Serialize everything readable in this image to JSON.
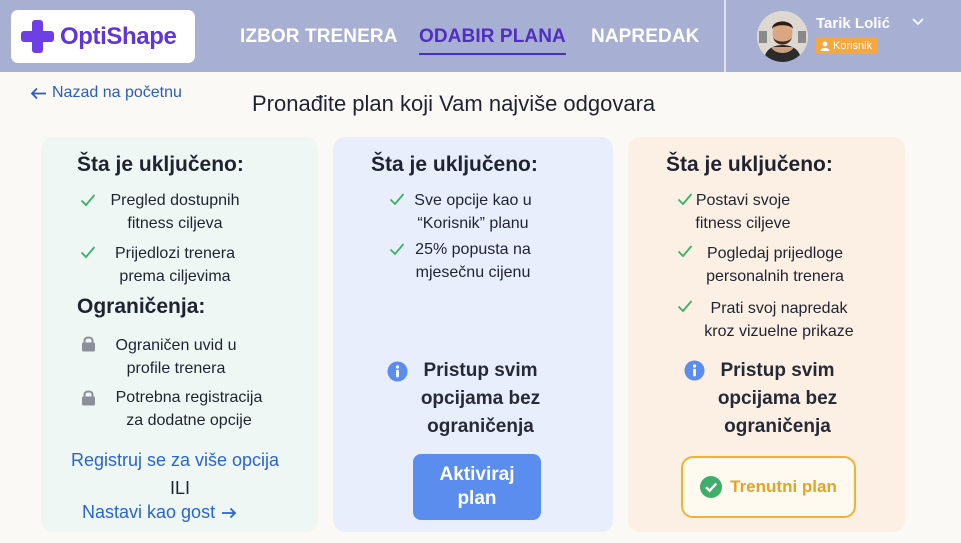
{
  "brand": {
    "name": "OptiShape"
  },
  "nav": {
    "links": [
      {
        "label": "IZBOR TRENERA",
        "active": false
      },
      {
        "label": "ODABIR PLANA",
        "active": true
      },
      {
        "label": "NAPREDAK",
        "active": false
      }
    ]
  },
  "user": {
    "name": "Tarik Lolić",
    "role": "Korisnik"
  },
  "back_link": "Nazad na početnu",
  "page_title": "Pronađite plan koji Vam najviše odgovara",
  "plans": [
    {
      "included_heading": "Šta je uključeno:",
      "included": [
        {
          "line1": "Pregled dostupnih",
          "line2": "fitness ciljeva"
        },
        {
          "line1": "Prijedlozi trenera",
          "line2": "prema ciljevima"
        }
      ],
      "limits_heading": "Ograničenja:",
      "limits": [
        {
          "line1": "Ograničen uvid u",
          "line2": "profile trenera"
        },
        {
          "line1": "Potrebna registracija",
          "line2": "za dodatne opcije"
        }
      ],
      "register_link": "Registruj se za više opcija",
      "or_text": "ILI",
      "guest_link": "Nastavi kao gost"
    },
    {
      "included_heading": "Šta je uključeno:",
      "included": [
        {
          "line1": "Sve opcije kao u",
          "line2": "“Korisnik” planu"
        },
        {
          "line1": "25% popusta na",
          "line2": "mjesečnu cijenu"
        }
      ],
      "info": {
        "line1": "Pristup svim",
        "line2": "opcijama bez",
        "line3": "ograničenja"
      },
      "button": {
        "line1": "Aktiviraj",
        "line2": "plan"
      }
    },
    {
      "included_heading": "Šta je uključeno:",
      "included": [
        {
          "line1": "Postavi svoje",
          "line2": "fitness ciljeve"
        },
        {
          "line1": "Pogledaj prijedloge",
          "line2": "personalnih trenera"
        },
        {
          "line1": "Prati svoj napredak",
          "line2": "kroz vizuelne prikaze"
        }
      ],
      "info": {
        "line1": "Pristup svim",
        "line2": "opcijama bez",
        "line3": "ograničenja"
      },
      "button": {
        "label": "Trenutni plan"
      }
    }
  ],
  "colors": {
    "nav_bg": "#a7afd3",
    "brand": "#5f36d8",
    "active_nav": "#4f2ec4",
    "check": "#3fae6a",
    "info": "#5b8dee",
    "activate_btn": "#5b8dee",
    "current_btn_border": "#f0b234",
    "current_btn_text": "#e5a325",
    "role_badge": "#f5a83c"
  },
  "icons": [
    "logo-cross-icon",
    "chevron-down-icon",
    "user-icon",
    "arrow-left-icon",
    "check-icon",
    "lock-icon",
    "info-icon",
    "arrow-right-icon",
    "check-circle-icon"
  ]
}
